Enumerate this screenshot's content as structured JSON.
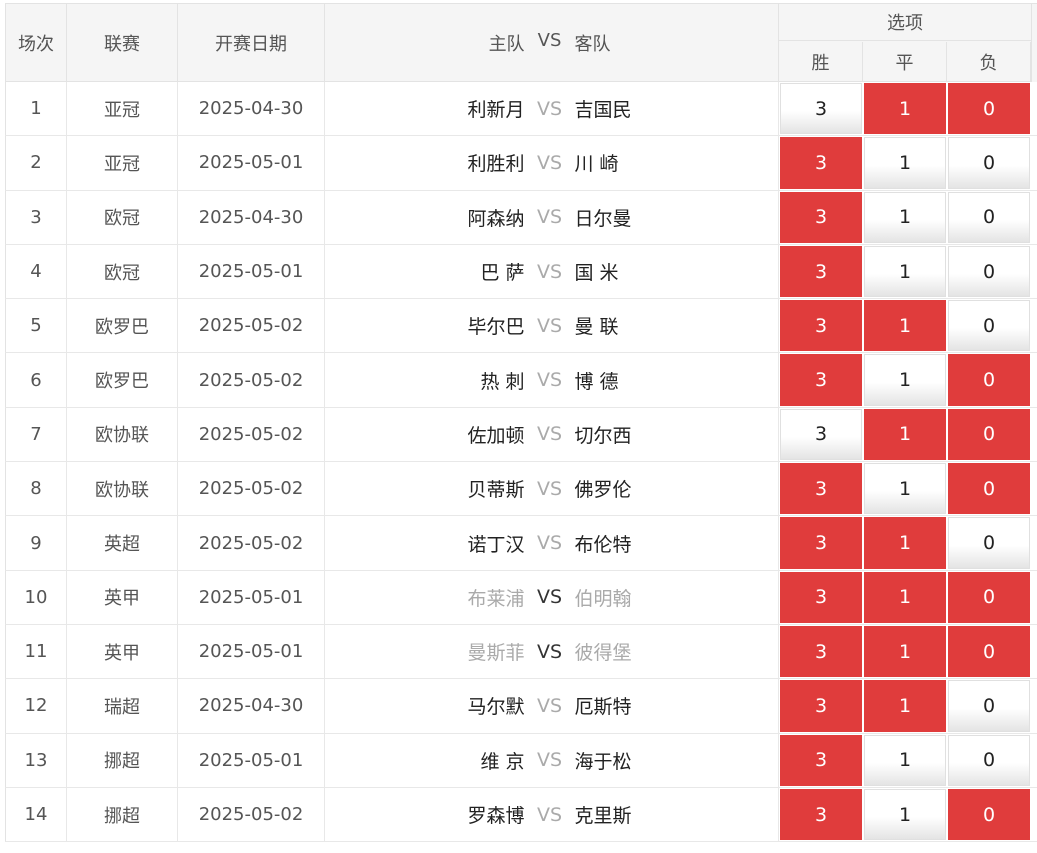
{
  "header": {
    "changci": "场次",
    "liansai": "联赛",
    "date": "开赛日期",
    "home": "主队",
    "vs": "VS",
    "away": "客队",
    "options_title": "选项",
    "opt_win": "胜",
    "opt_draw": "平",
    "opt_lose": "负"
  },
  "colors": {
    "selected": "#e03c3c",
    "unselected": "#ffffff"
  },
  "rows": [
    {
      "idx": "1",
      "league": "亚冠",
      "date": "2025-04-30",
      "home": "利新月",
      "vs": "VS",
      "away": "吉国民",
      "w": "3",
      "d": "1",
      "l": "0",
      "sel": [
        false,
        true,
        true
      ],
      "grey": false
    },
    {
      "idx": "2",
      "league": "亚冠",
      "date": "2025-05-01",
      "home": "利胜利",
      "vs": "VS",
      "away": "川 崎",
      "w": "3",
      "d": "1",
      "l": "0",
      "sel": [
        true,
        false,
        false
      ],
      "grey": false
    },
    {
      "idx": "3",
      "league": "欧冠",
      "date": "2025-04-30",
      "home": "阿森纳",
      "vs": "VS",
      "away": "日尔曼",
      "w": "3",
      "d": "1",
      "l": "0",
      "sel": [
        true,
        false,
        false
      ],
      "grey": false
    },
    {
      "idx": "4",
      "league": "欧冠",
      "date": "2025-05-01",
      "home": "巴 萨",
      "vs": "VS",
      "away": "国 米",
      "w": "3",
      "d": "1",
      "l": "0",
      "sel": [
        true,
        false,
        false
      ],
      "grey": false
    },
    {
      "idx": "5",
      "league": "欧罗巴",
      "date": "2025-05-02",
      "home": "毕尔巴",
      "vs": "VS",
      "away": "曼 联",
      "w": "3",
      "d": "1",
      "l": "0",
      "sel": [
        true,
        true,
        false
      ],
      "grey": false
    },
    {
      "idx": "6",
      "league": "欧罗巴",
      "date": "2025-05-02",
      "home": "热 刺",
      "vs": "VS",
      "away": "博 德",
      "w": "3",
      "d": "1",
      "l": "0",
      "sel": [
        true,
        false,
        true
      ],
      "grey": false
    },
    {
      "idx": "7",
      "league": "欧协联",
      "date": "2025-05-02",
      "home": "佐加顿",
      "vs": "VS",
      "away": "切尔西",
      "w": "3",
      "d": "1",
      "l": "0",
      "sel": [
        false,
        true,
        true
      ],
      "grey": false
    },
    {
      "idx": "8",
      "league": "欧协联",
      "date": "2025-05-02",
      "home": "贝蒂斯",
      "vs": "VS",
      "away": "佛罗伦",
      "w": "3",
      "d": "1",
      "l": "0",
      "sel": [
        true,
        false,
        true
      ],
      "grey": false
    },
    {
      "idx": "9",
      "league": "英超",
      "date": "2025-05-02",
      "home": "诺丁汉",
      "vs": "VS",
      "away": "布伦特",
      "w": "3",
      "d": "1",
      "l": "0",
      "sel": [
        true,
        true,
        false
      ],
      "grey": false
    },
    {
      "idx": "10",
      "league": "英甲",
      "date": "2025-05-01",
      "home": "布莱浦",
      "vs": "VS",
      "away": "伯明翰",
      "w": "3",
      "d": "1",
      "l": "0",
      "sel": [
        true,
        true,
        true
      ],
      "grey": true
    },
    {
      "idx": "11",
      "league": "英甲",
      "date": "2025-05-01",
      "home": "曼斯菲",
      "vs": "VS",
      "away": "彼得堡",
      "w": "3",
      "d": "1",
      "l": "0",
      "sel": [
        true,
        true,
        true
      ],
      "grey": true
    },
    {
      "idx": "12",
      "league": "瑞超",
      "date": "2025-04-30",
      "home": "马尔默",
      "vs": "VS",
      "away": "厄斯特",
      "w": "3",
      "d": "1",
      "l": "0",
      "sel": [
        true,
        true,
        false
      ],
      "grey": false
    },
    {
      "idx": "13",
      "league": "挪超",
      "date": "2025-05-01",
      "home": "维 京",
      "vs": "VS",
      "away": "海于松",
      "w": "3",
      "d": "1",
      "l": "0",
      "sel": [
        true,
        false,
        false
      ],
      "grey": false
    },
    {
      "idx": "14",
      "league": "挪超",
      "date": "2025-05-02",
      "home": "罗森博",
      "vs": "VS",
      "away": "克里斯",
      "w": "3",
      "d": "1",
      "l": "0",
      "sel": [
        true,
        false,
        true
      ],
      "grey": false
    }
  ]
}
